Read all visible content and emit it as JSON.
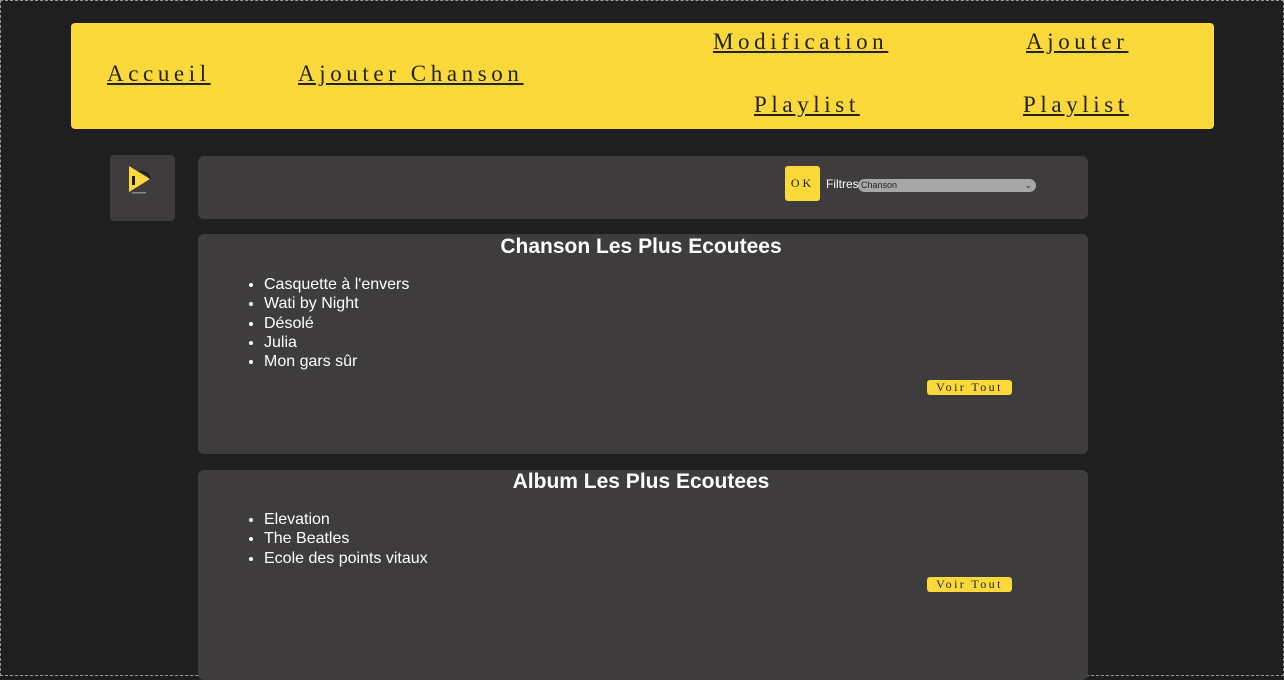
{
  "nav": {
    "accueil": "Accueil",
    "ajouter_chanson": "Ajouter Chanson",
    "modification_playlist_1": "Modification",
    "modification_playlist_2": "Playlist",
    "ajouter_playlist_1": "Ajouter",
    "ajouter_playlist_2": "Playlist"
  },
  "filters": {
    "ok_label": "OK",
    "label": "Filtres",
    "selected": "Chanson"
  },
  "songs": {
    "title": "Chanson Les Plus Ecoutees",
    "items": [
      "Casquette à l'envers",
      "Wati by Night",
      "Désolé",
      "Julia",
      "Mon gars sûr"
    ],
    "button": "Voir Tout"
  },
  "albums": {
    "title": "Album Les Plus Ecoutees",
    "items": [
      "Elevation",
      "The Beatles",
      "Ecole des points vitaux"
    ],
    "button": "Voir Tout"
  },
  "colors": {
    "accent": "#fcd93a",
    "background": "#1f1f1f",
    "panel": "#3e3c3d"
  },
  "icons": {
    "logo": "play-logo-icon",
    "select": "chevron-down-icon"
  }
}
